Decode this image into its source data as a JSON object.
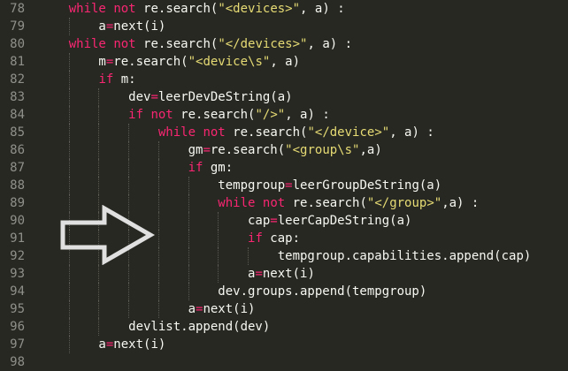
{
  "editor": {
    "lines": [
      {
        "n": "78",
        "tokens": [
          {
            "t": "    "
          },
          {
            "t": "while",
            "c": "kw"
          },
          {
            "t": " "
          },
          {
            "t": "not",
            "c": "kw"
          },
          {
            "t": " re.search("
          },
          {
            "t": "\"<devices>\"",
            "c": "str"
          },
          {
            "t": ", a) :"
          }
        ]
      },
      {
        "n": "79",
        "tokens": [
          {
            "t": "        a"
          },
          {
            "t": "=",
            "c": "kw"
          },
          {
            "t": "next(i)"
          }
        ]
      },
      {
        "n": "80",
        "tokens": [
          {
            "t": "    "
          },
          {
            "t": "while",
            "c": "kw"
          },
          {
            "t": " "
          },
          {
            "t": "not",
            "c": "kw"
          },
          {
            "t": " re.search("
          },
          {
            "t": "\"</devices>\"",
            "c": "str"
          },
          {
            "t": ", a) :"
          }
        ]
      },
      {
        "n": "81",
        "tokens": [
          {
            "t": "        m"
          },
          {
            "t": "=",
            "c": "kw"
          },
          {
            "t": "re.search("
          },
          {
            "t": "\"<device\\s\"",
            "c": "str"
          },
          {
            "t": ", a)"
          }
        ]
      },
      {
        "n": "82",
        "tokens": [
          {
            "t": "        "
          },
          {
            "t": "if",
            "c": "kw"
          },
          {
            "t": " m:"
          }
        ]
      },
      {
        "n": "83",
        "tokens": [
          {
            "t": "            dev"
          },
          {
            "t": "=",
            "c": "kw"
          },
          {
            "t": "leerDevDeString(a)"
          }
        ]
      },
      {
        "n": "84",
        "tokens": [
          {
            "t": "            "
          },
          {
            "t": "if",
            "c": "kw"
          },
          {
            "t": " "
          },
          {
            "t": "not",
            "c": "kw"
          },
          {
            "t": " re.search("
          },
          {
            "t": "\"/>\"",
            "c": "str"
          },
          {
            "t": ", a) :"
          }
        ]
      },
      {
        "n": "85",
        "tokens": [
          {
            "t": "                "
          },
          {
            "t": "while",
            "c": "kw"
          },
          {
            "t": " "
          },
          {
            "t": "not",
            "c": "kw"
          },
          {
            "t": " re.search("
          },
          {
            "t": "\"</device>\"",
            "c": "str"
          },
          {
            "t": ", a) :"
          }
        ]
      },
      {
        "n": "86",
        "tokens": [
          {
            "t": "                    gm"
          },
          {
            "t": "=",
            "c": "kw"
          },
          {
            "t": "re.search("
          },
          {
            "t": "\"<group\\s\"",
            "c": "str"
          },
          {
            "t": ",a)"
          }
        ]
      },
      {
        "n": "87",
        "tokens": [
          {
            "t": "                    "
          },
          {
            "t": "if",
            "c": "kw"
          },
          {
            "t": " gm:"
          }
        ]
      },
      {
        "n": "88",
        "tokens": [
          {
            "t": "                        tempgroup"
          },
          {
            "t": "=",
            "c": "kw"
          },
          {
            "t": "leerGroupDeString(a)"
          }
        ]
      },
      {
        "n": "89",
        "tokens": [
          {
            "t": "                        "
          },
          {
            "t": "while",
            "c": "kw"
          },
          {
            "t": " "
          },
          {
            "t": "not",
            "c": "kw"
          },
          {
            "t": " re.search("
          },
          {
            "t": "\"</group>\"",
            "c": "str"
          },
          {
            "t": ",a) :"
          }
        ]
      },
      {
        "n": "90",
        "tokens": [
          {
            "t": "                            cap"
          },
          {
            "t": "=",
            "c": "kw"
          },
          {
            "t": "leerCapDeString(a)"
          }
        ]
      },
      {
        "n": "91",
        "tokens": [
          {
            "t": "                            "
          },
          {
            "t": "if",
            "c": "kw"
          },
          {
            "t": " cap:"
          }
        ]
      },
      {
        "n": "92",
        "tokens": [
          {
            "t": "                                tempgroup.capabilities.append(cap)"
          }
        ]
      },
      {
        "n": "93",
        "tokens": [
          {
            "t": "                            a"
          },
          {
            "t": "=",
            "c": "kw"
          },
          {
            "t": "next(i)"
          }
        ]
      },
      {
        "n": "94",
        "tokens": [
          {
            "t": "                        dev.groups.append(tempgroup)"
          }
        ]
      },
      {
        "n": "95",
        "tokens": [
          {
            "t": "                    a"
          },
          {
            "t": "=",
            "c": "kw"
          },
          {
            "t": "next(i)"
          }
        ]
      },
      {
        "n": "96",
        "tokens": [
          {
            "t": "            devlist.append(dev)"
          }
        ]
      },
      {
        "n": "97",
        "tokens": [
          {
            "t": "        a"
          },
          {
            "t": "=",
            "c": "kw"
          },
          {
            "t": "next(i)"
          }
        ]
      },
      {
        "n": "98",
        "tokens": []
      }
    ]
  },
  "overlay": {
    "arrow_icon": "right-arrow-outline-icon",
    "arrow_color": "#e0e0e0"
  },
  "colors": {
    "background": "#272822",
    "text": "#f8f8f2",
    "keyword": "#f92672",
    "string": "#e6db74",
    "line_number": "#90908a"
  }
}
